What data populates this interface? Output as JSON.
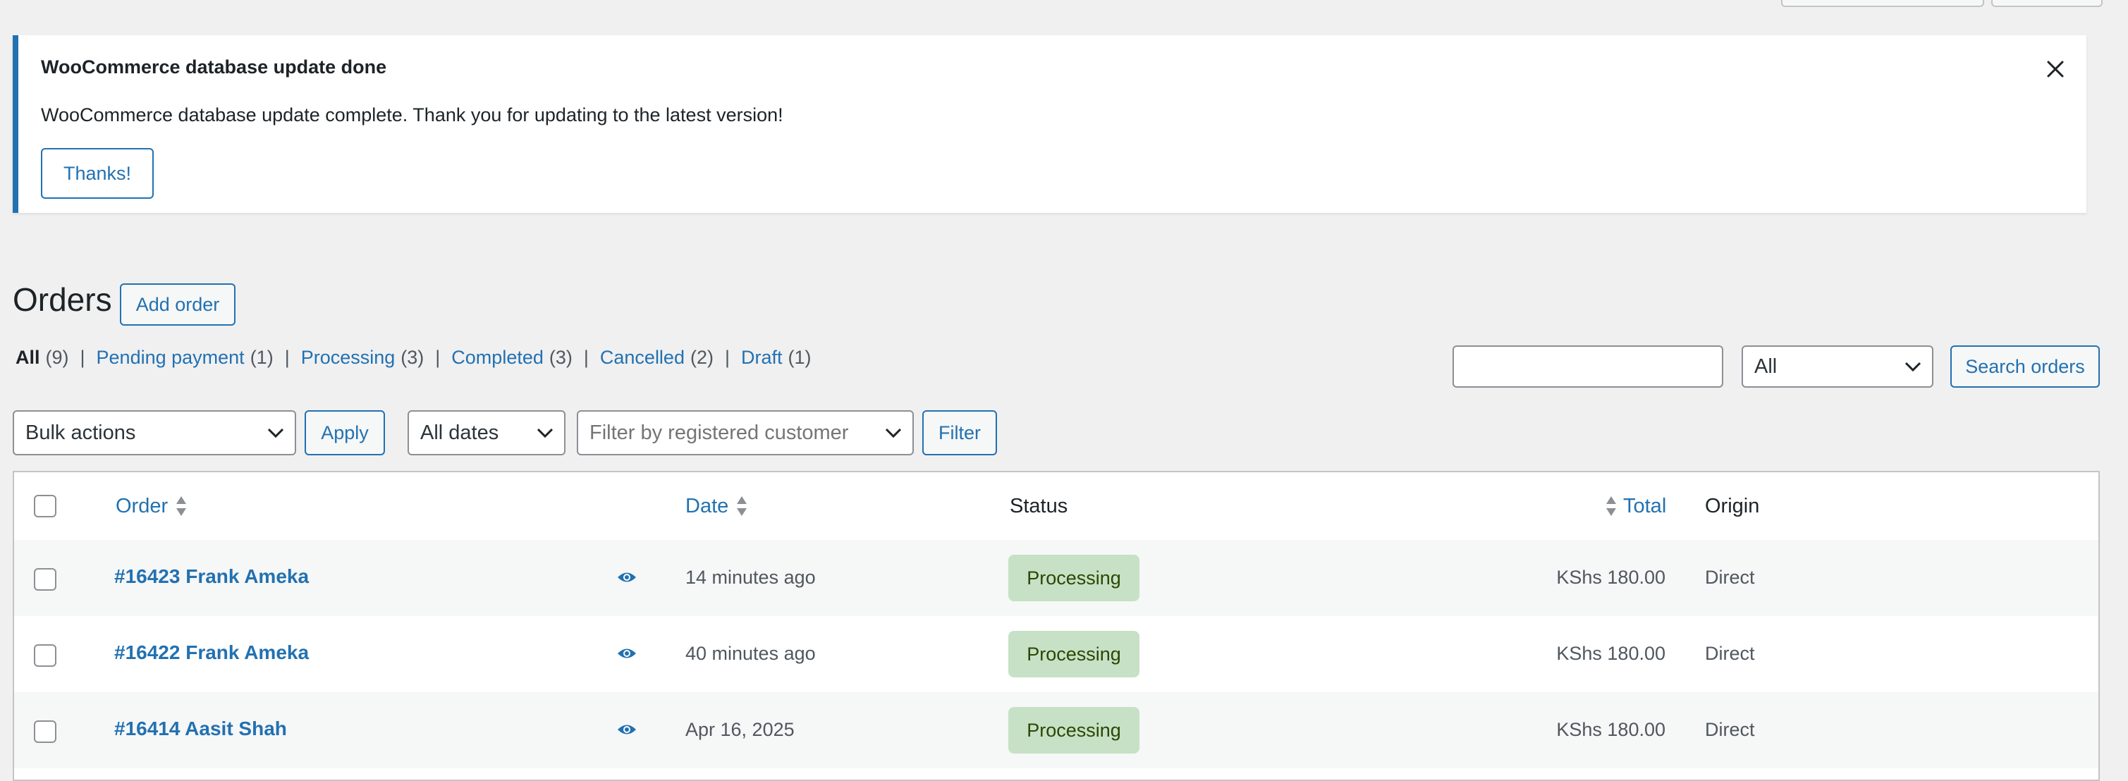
{
  "notice": {
    "title": "WooCommerce database update done",
    "message": "WooCommerce database update complete. Thank you for updating to the latest version!",
    "button": "Thanks!"
  },
  "page": {
    "title": "Orders",
    "add_button": "Add order"
  },
  "status_filters": [
    {
      "label": "All",
      "count": "(9)"
    },
    {
      "label": "Pending payment",
      "count": "(1)"
    },
    {
      "label": "Processing",
      "count": "(3)"
    },
    {
      "label": "Completed",
      "count": "(3)"
    },
    {
      "label": "Cancelled",
      "count": "(2)"
    },
    {
      "label": "Draft",
      "count": "(1)"
    }
  ],
  "search": {
    "value": "",
    "type_select": "All",
    "button": "Search orders"
  },
  "toolbar": {
    "bulk_actions": "Bulk actions",
    "apply": "Apply",
    "dates": "All dates",
    "customer_placeholder": "Filter by registered customer",
    "filter": "Filter"
  },
  "table": {
    "columns": {
      "order": "Order",
      "date": "Date",
      "status": "Status",
      "total": "Total",
      "origin": "Origin"
    },
    "rows": [
      {
        "order": "#16423 Frank Ameka",
        "date": "14 minutes ago",
        "status": "Processing",
        "total": "KShs 180.00",
        "origin": "Direct"
      },
      {
        "order": "#16422 Frank Ameka",
        "date": "40 minutes ago",
        "status": "Processing",
        "total": "KShs 180.00",
        "origin": "Direct"
      },
      {
        "order": "#16414 Aasit Shah",
        "date": "Apr 16, 2025",
        "status": "Processing",
        "total": "KShs 180.00",
        "origin": "Direct"
      }
    ]
  },
  "colors": {
    "accent": "#2271b1",
    "processing_bg": "#c6e1c6",
    "processing_text": "#2c4700"
  },
  "icons": {
    "close": "close-icon",
    "chevron": "chevron-down-icon",
    "sort": "sort-icon",
    "preview": "eye-icon"
  }
}
